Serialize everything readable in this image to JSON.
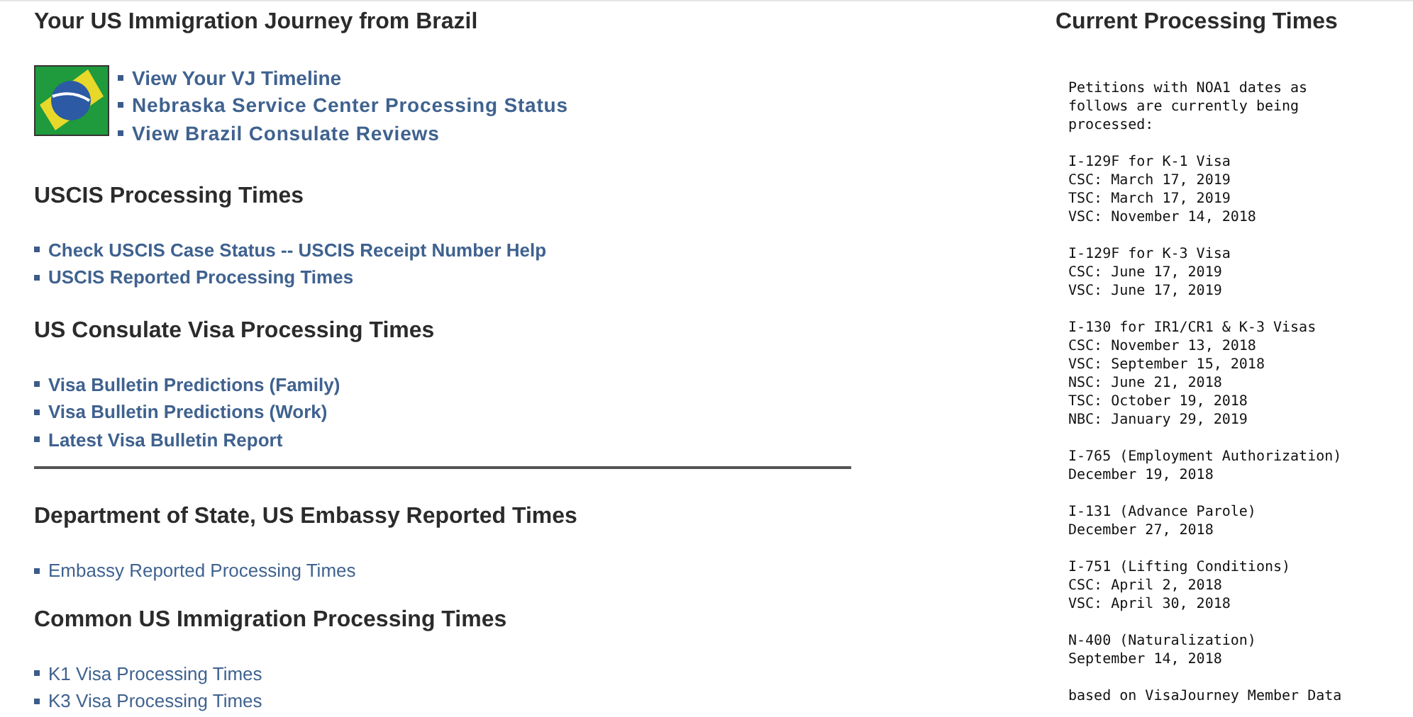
{
  "title": "Your US Immigration Journey from Brazil",
  "journey_links": [
    {
      "label": "View Your VJ Timeline",
      "kind": "medium"
    },
    {
      "label": "Nebraska Service Center Processing Status",
      "kind": "bold"
    },
    {
      "label": "View Brazil Consulate Reviews",
      "kind": "bold"
    }
  ],
  "sections": [
    {
      "heading": "USCIS Processing Times",
      "rule_after": false,
      "links": [
        {
          "label": "Check USCIS Case Status -- USCIS Receipt Number Help",
          "kind": "medium"
        },
        {
          "label": "USCIS Reported Processing Times",
          "kind": "medium"
        }
      ]
    },
    {
      "heading": "US Consulate Visa Processing Times",
      "rule_after": true,
      "links": [
        {
          "label": "Visa Bulletin Predictions (Family)",
          "kind": "medium"
        },
        {
          "label": "Visa Bulletin Predictions (Work)",
          "kind": "medium"
        },
        {
          "label": "Latest Visa Bulletin Report",
          "kind": "medium"
        }
      ]
    },
    {
      "heading": "Department of State, US Embassy Reported Times",
      "rule_after": false,
      "links": [
        {
          "label": "Embassy Reported Processing Times",
          "kind": "regular"
        }
      ]
    },
    {
      "heading": "Common US Immigration Processing Times",
      "rule_after": false,
      "links": [
        {
          "label": "K1 Visa Processing Times",
          "kind": "regular"
        },
        {
          "label": "K3 Visa Processing Times",
          "kind": "regular"
        }
      ]
    }
  ],
  "sidebar": {
    "heading": "Current Processing Times",
    "blocks": [
      [
        "Petitions with NOA1 dates as",
        "follows are currently being",
        "processed:"
      ],
      [
        "I-129F for K-1 Visa",
        "CSC: March 17, 2019",
        "TSC: March 17, 2019",
        "VSC: November 14, 2018"
      ],
      [
        "I-129F for K-3 Visa",
        "CSC: June 17, 2019",
        "VSC: June 17, 2019"
      ],
      [
        "I-130 for IR1/CR1 & K-3 Visas",
        "CSC: November 13, 2018",
        "VSC: September 15, 2018",
        "NSC: June 21, 2018",
        "TSC: October 19, 2018",
        "NBC: January 29, 2019"
      ],
      [
        "I-765 (Employment Authorization)",
        "December 19, 2018"
      ],
      [
        "I-131 (Advance Parole)",
        "December 27, 2018"
      ],
      [
        "I-751 (Lifting Conditions)",
        "CSC: April 2, 2018",
        "VSC: April 30, 2018"
      ],
      [
        "N-400 (Naturalization)",
        "September 14, 2018"
      ],
      [
        "based on VisaJourney Member Data"
      ]
    ]
  }
}
